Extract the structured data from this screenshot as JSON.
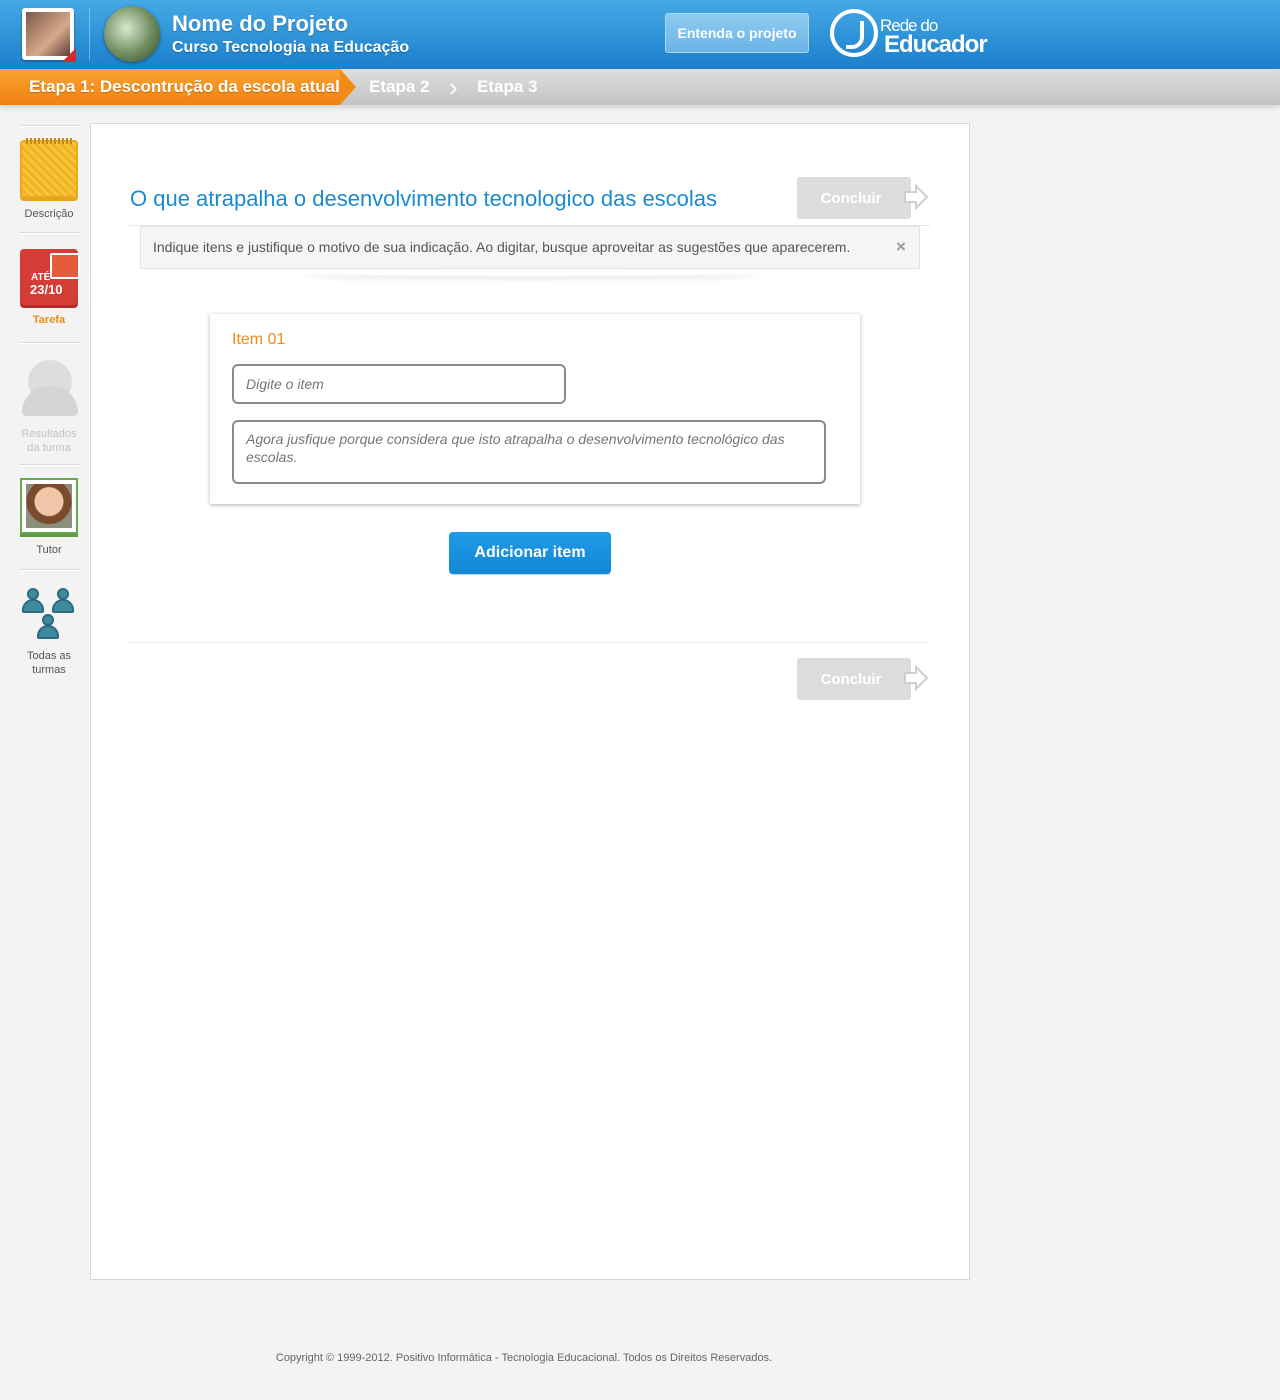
{
  "header": {
    "project_title": "Nome do Projeto",
    "project_subtitle": "Curso Tecnologia na Educação",
    "entenda_label": "Entenda o projeto",
    "logo_line1": "Rede do",
    "logo_line2": "Educador"
  },
  "steps": {
    "step1": "Etapa 1: Descontrução da escola atual",
    "step2": "Etapa 2",
    "step3": "Etapa 3"
  },
  "sidebar": {
    "descricao": "Descrição",
    "tarefa": "Tarefa",
    "tarefa_badge_top": "ATÉ",
    "tarefa_badge_date": "23/10",
    "resultados_line1": "Resultados",
    "resultados_line2": "da turma",
    "tutor": "Tutor",
    "todas_line1": "Todas as",
    "todas_line2": "turmas"
  },
  "main": {
    "title": "O que atrapalha o desenvolvimento tecnologico das escolas",
    "concluir_label": "Concluir",
    "hint": "Indique itens e justifique o motivo de sua indicação. Ao digitar, busque aproveitar as sugestões que aparecerem.",
    "hint_close": "×",
    "item_label": "Item 01",
    "item_placeholder": "Digite o item",
    "justify_placeholder": "Agora jusfique porque considera que isto atrapalha o desenvolvimento tecnológico das escolas.",
    "add_label": "Adicionar item"
  },
  "footer": {
    "copyright": "Copyright © 1999-2012.  Positivo Informática - Tecnologia Educacional. Todos os Direitos Reservados."
  },
  "colors": {
    "header_blue": "#1b7fcb",
    "step_orange": "#f28a16",
    "title_blue": "#1a8ad1",
    "button_blue": "#1287d6"
  }
}
